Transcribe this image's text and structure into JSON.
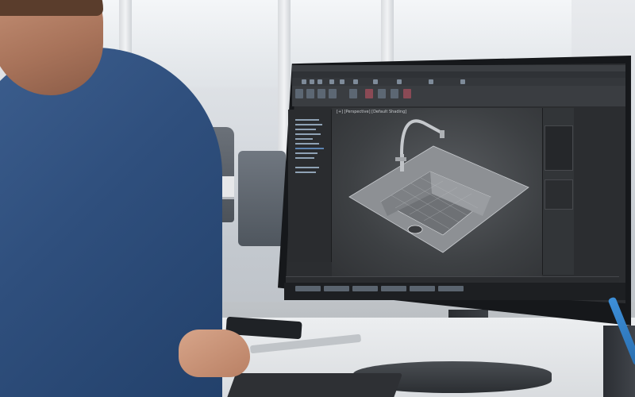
{
  "scene": {
    "description_visible_text": "",
    "app": {
      "name": "3D modeling application",
      "viewport_label": "[+] [Perspective] [Default Shading]"
    },
    "colors": {
      "ui_dark": "#2b2d30",
      "ui_mid": "#3a3d41",
      "accent_blue": "#7e8b99",
      "shirt": "#2f4f7d"
    },
    "icons": {
      "sink": "sink-model-icon",
      "faucet": "faucet-model-icon"
    }
  }
}
